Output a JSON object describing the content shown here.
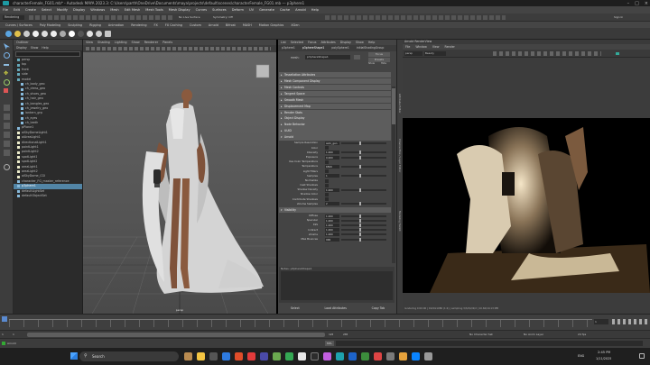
{
  "window": {
    "title": "characterFemale_FG01.mb* - Autodesk MAYA 2023.3: C:\\Users\\parth\\OneDrive\\Documents\\maya\\projects\\default\\scenes\\characterFemale_FG01.mb  ---  p3phere1"
  },
  "menubar": [
    "File",
    "Edit",
    "Create",
    "Select",
    "Modify",
    "Display",
    "Windows",
    "Mesh",
    "Edit Mesh",
    "Mesh Tools",
    "Mesh Display",
    "Curves",
    "Surfaces",
    "Deform",
    "UV",
    "Generate",
    "Cache",
    "Arnold",
    "Help"
  ],
  "statusline": {
    "workspace_label": "Rendering",
    "no_live_surface": "No Live Surface",
    "symmetry": "Symmetry: Off",
    "sign_in": "Sign In"
  },
  "shelf_tabs": [
    "Curves / Surfaces",
    "Poly Modeling",
    "Sculpting",
    "Rigging",
    "Animation",
    "Rendering",
    "FX",
    "FX Caching",
    "Custom",
    "Arnold",
    "Bifrost",
    "MASH",
    "Motion Graphics",
    "XGen"
  ],
  "outliner": {
    "title": "Outliner",
    "menu": [
      "Display",
      "Show",
      "Help"
    ],
    "items": [
      {
        "label": "persp",
        "selected": false
      },
      {
        "label": "top",
        "selected": false
      },
      {
        "label": "front",
        "selected": false
      },
      {
        "label": "side",
        "selected": false
      },
      {
        "label": "model",
        "selected": false
      },
      {
        "label": "ch_body_geo",
        "selected": false
      },
      {
        "label": "ch_dress_geo",
        "selected": false
      },
      {
        "label": "ch_shoes_geo",
        "selected": false
      },
      {
        "label": "ch_hair_geo",
        "selected": false
      },
      {
        "label": "ch_bangles_geo",
        "selected": false
      },
      {
        "label": "ch_jewelry_geo",
        "selected": false
      },
      {
        "label": "lantern_grp",
        "selected": false
      },
      {
        "label": "ch_eyes",
        "selected": false
      },
      {
        "label": "ch_teeth",
        "selected": false
      },
      {
        "label": "pPlane1",
        "selected": false
      },
      {
        "label": "aiSkyDomeLight1",
        "selected": false
      },
      {
        "label": "aiAreaLight1",
        "selected": false
      },
      {
        "label": "directionalLight1",
        "selected": false
      },
      {
        "label": "pointLight1",
        "selected": false
      },
      {
        "label": "pointLight2",
        "selected": false
      },
      {
        "label": "spotLight1",
        "selected": false
      },
      {
        "label": "spotLight2",
        "selected": false
      },
      {
        "label": "areaLight1",
        "selected": false
      },
      {
        "label": "areaLight2",
        "selected": false
      },
      {
        "label": "aiSkyDome_CGI",
        "selected": false
      },
      {
        "label": "character_FG_master_reference",
        "selected": false
      },
      {
        "label": "p3phere1",
        "selected": true
      },
      {
        "label": "defaultLightSet",
        "selected": false
      },
      {
        "label": "defaultObjectSet",
        "selected": false
      }
    ]
  },
  "viewport": {
    "menu": [
      "View",
      "Shading",
      "Lighting",
      "Show",
      "Renderer",
      "Panels"
    ],
    "camera_label": "persp"
  },
  "attribute_editor": {
    "menu": [
      "List",
      "Selected",
      "Focus",
      "Attributes",
      "Display",
      "Show",
      "Help"
    ],
    "tabs": [
      "p3phere1",
      "p3phereShape1",
      "polySphere1",
      "initialShadingGroup"
    ],
    "mesh_label": "mesh:",
    "mesh_value": "p3phereShape1",
    "focus_btn": "Focus",
    "presets_btn": "Presets",
    "show_btn": "Show",
    "hide_btn": "Hide",
    "sections": [
      {
        "label": "Tessellation Attributes",
        "open": false
      },
      {
        "label": "Mesh Component Display",
        "open": false
      },
      {
        "label": "Mesh Controls",
        "open": false
      },
      {
        "label": "Tangent Space",
        "open": false
      },
      {
        "label": "Smooth Mesh",
        "open": false
      },
      {
        "label": "Displacement Map",
        "open": false
      },
      {
        "label": "Render Stats",
        "open": false
      },
      {
        "label": "Object Display",
        "open": false
      },
      {
        "label": "Node Behavior",
        "open": false
      },
      {
        "label": "UUID",
        "open": false
      },
      {
        "label": "Arnold",
        "open": true
      }
    ],
    "arnold_rows": [
      {
        "label": "Sample Resolution",
        "value": "auto_gen"
      },
      {
        "label": "Color",
        "value": ""
      },
      {
        "label": "Intensity",
        "value": "1.000"
      },
      {
        "label": "Exposure",
        "value": "0.000"
      },
      {
        "label": "Use Color Temperature",
        "value": ""
      },
      {
        "label": "Temperature",
        "value": "6500"
      },
      {
        "label": "Light Filters",
        "value": ""
      },
      {
        "label": "Samples",
        "value": "1"
      },
      {
        "label": "Normalize",
        "value": ""
      },
      {
        "label": "Cast Shadows",
        "value": ""
      },
      {
        "label": "Shadow Density",
        "value": "1.000"
      },
      {
        "label": "Shadow Color",
        "value": ""
      },
      {
        "label": "Contribute Shadows",
        "value": ""
      },
      {
        "label": "Volume Samples",
        "value": "2"
      }
    ],
    "visibility_label": "Visibility",
    "visibility_rows": [
      {
        "label": "Diffuse",
        "value": "1.000"
      },
      {
        "label": "Specular",
        "value": "1.000"
      },
      {
        "label": "SSS",
        "value": "1.000"
      },
      {
        "label": "Indirect",
        "value": "1.000"
      },
      {
        "label": "Volume",
        "value": "1.000"
      },
      {
        "label": "Max Bounces",
        "value": "999"
      }
    ],
    "notes_label": "Notes:  p3phereShape1",
    "select_btn": "Select",
    "load_btn": "Load Attributes",
    "copy_btn": "Copy Tab"
  },
  "side_tabs": [
    "Attribute Editor",
    "Channel Box / Layer Editor",
    "Modeling Toolkit"
  ],
  "render_view": {
    "title": "Arnold RenderView",
    "menu": [
      "File",
      "Window",
      "View",
      "Render"
    ],
    "camera": "persp",
    "aov": "Beauty",
    "status": "rendering 0:00:00 | 1920x1080 (1:2) | sampling 3/3/2/2/2/2 | 10.62/10.13 MB"
  },
  "timeslider": {
    "start": "1",
    "end": "120",
    "range_start": "1",
    "range_end": "120",
    "anim_end": "200",
    "current_frame": "1",
    "fps": "24 fps",
    "no_character_set": "No Character Set",
    "no_anim_layer": "No Anim Layer"
  },
  "command_line": {
    "mel_label": "MEL",
    "help_text": "Arnold"
  },
  "taskbar": {
    "search_label": "Search",
    "lang": "ENG",
    "time": "2:45 PM",
    "date": "1/11/2025"
  }
}
